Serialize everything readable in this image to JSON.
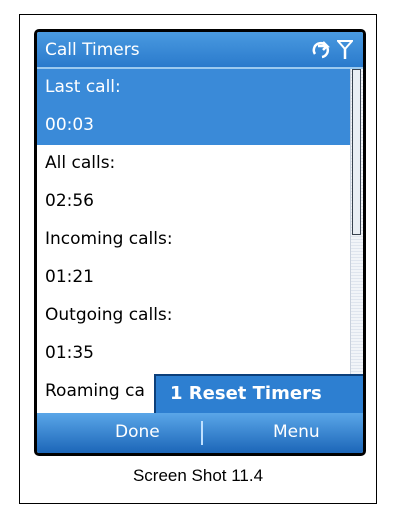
{
  "title": "Call Timers",
  "status_icons": [
    "sync-icon",
    "signal-icon"
  ],
  "rows": [
    {
      "text": "Last call:",
      "selected": true
    },
    {
      "text": "00:03",
      "selected": true
    },
    {
      "text": "All calls:",
      "selected": false
    },
    {
      "text": "02:56",
      "selected": false
    },
    {
      "text": "Incoming calls:",
      "selected": false
    },
    {
      "text": "01:21",
      "selected": false
    },
    {
      "text": "Outgoing calls:",
      "selected": false
    },
    {
      "text": "01:35",
      "selected": false
    },
    {
      "text": "Roaming ca",
      "selected": false
    }
  ],
  "popup": {
    "label": "1 Reset Timers"
  },
  "softkeys": {
    "left": "Done",
    "right": "Menu"
  },
  "caption": "Screen Shot 11.4",
  "colors": {
    "accent": "#3a8ad8",
    "popup": "#2d7fd1"
  }
}
